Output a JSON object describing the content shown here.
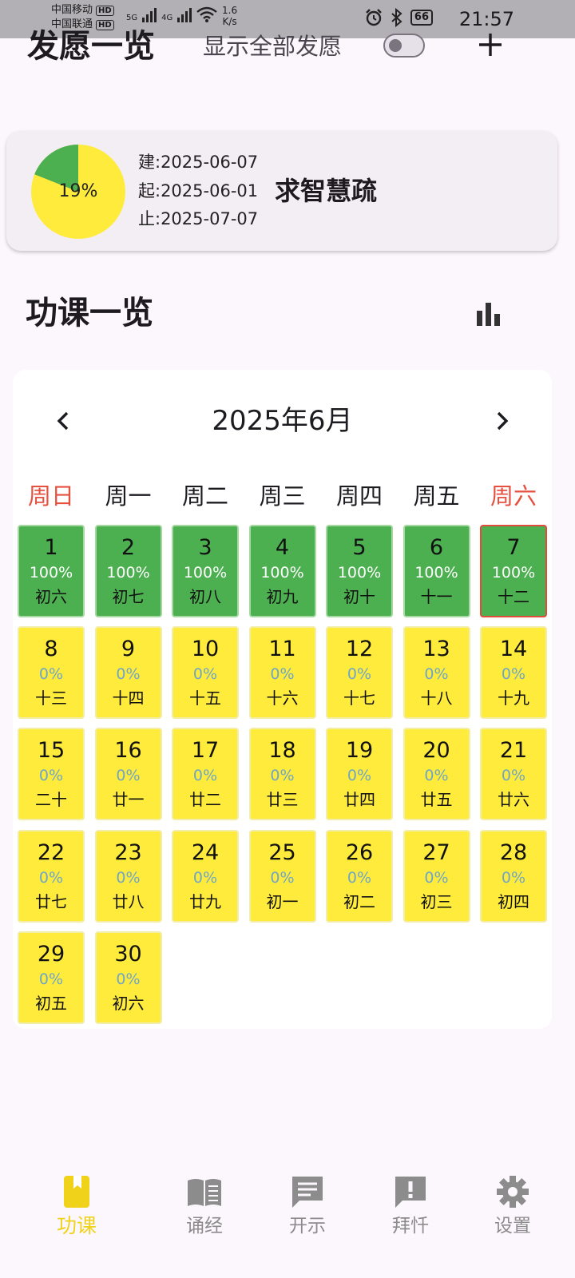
{
  "status_bar": {
    "carrier1": "中国移动",
    "carrier2": "中国联通",
    "hd": "HD",
    "net1": "5G",
    "net2": "4G",
    "speed_value": "1.6",
    "speed_unit": "K/s",
    "battery": "66",
    "time": "21:57"
  },
  "header": {
    "title": "发愿一览",
    "show_all_label": "显示全部发愿",
    "show_all_on": false
  },
  "vow": {
    "progress_percent": 19,
    "progress_label": "19%",
    "created": "建:2025-06-07",
    "start": "起:2025-06-01",
    "end": "止:2025-07-07",
    "name": "求智慧疏",
    "colors": {
      "done": "#4caf50",
      "remaining": "#ffeb3b"
    }
  },
  "section": {
    "title": "功课一览"
  },
  "calendar": {
    "month_label": "2025年6月",
    "weekdays": [
      "周日",
      "周一",
      "周二",
      "周三",
      "周四",
      "周五",
      "周六"
    ],
    "first_weekday": 0,
    "today": 7,
    "days": [
      {
        "d": "1",
        "pct": "100%",
        "lunar": "初六",
        "done": true
      },
      {
        "d": "2",
        "pct": "100%",
        "lunar": "初七",
        "done": true
      },
      {
        "d": "3",
        "pct": "100%",
        "lunar": "初八",
        "done": true
      },
      {
        "d": "4",
        "pct": "100%",
        "lunar": "初九",
        "done": true
      },
      {
        "d": "5",
        "pct": "100%",
        "lunar": "初十",
        "done": true
      },
      {
        "d": "6",
        "pct": "100%",
        "lunar": "十一",
        "done": true
      },
      {
        "d": "7",
        "pct": "100%",
        "lunar": "十二",
        "done": true
      },
      {
        "d": "8",
        "pct": "0%",
        "lunar": "十三",
        "done": false
      },
      {
        "d": "9",
        "pct": "0%",
        "lunar": "十四",
        "done": false
      },
      {
        "d": "10",
        "pct": "0%",
        "lunar": "十五",
        "done": false
      },
      {
        "d": "11",
        "pct": "0%",
        "lunar": "十六",
        "done": false
      },
      {
        "d": "12",
        "pct": "0%",
        "lunar": "十七",
        "done": false
      },
      {
        "d": "13",
        "pct": "0%",
        "lunar": "十八",
        "done": false
      },
      {
        "d": "14",
        "pct": "0%",
        "lunar": "十九",
        "done": false
      },
      {
        "d": "15",
        "pct": "0%",
        "lunar": "二十",
        "done": false
      },
      {
        "d": "16",
        "pct": "0%",
        "lunar": "廿一",
        "done": false
      },
      {
        "d": "17",
        "pct": "0%",
        "lunar": "廿二",
        "done": false
      },
      {
        "d": "18",
        "pct": "0%",
        "lunar": "廿三",
        "done": false
      },
      {
        "d": "19",
        "pct": "0%",
        "lunar": "廿四",
        "done": false
      },
      {
        "d": "20",
        "pct": "0%",
        "lunar": "廿五",
        "done": false
      },
      {
        "d": "21",
        "pct": "0%",
        "lunar": "廿六",
        "done": false
      },
      {
        "d": "22",
        "pct": "0%",
        "lunar": "廿七",
        "done": false
      },
      {
        "d": "23",
        "pct": "0%",
        "lunar": "廿八",
        "done": false
      },
      {
        "d": "24",
        "pct": "0%",
        "lunar": "廿九",
        "done": false
      },
      {
        "d": "25",
        "pct": "0%",
        "lunar": "初一",
        "done": false
      },
      {
        "d": "26",
        "pct": "0%",
        "lunar": "初二",
        "done": false
      },
      {
        "d": "27",
        "pct": "0%",
        "lunar": "初三",
        "done": false
      },
      {
        "d": "28",
        "pct": "0%",
        "lunar": "初四",
        "done": false
      },
      {
        "d": "29",
        "pct": "0%",
        "lunar": "初五",
        "done": false
      },
      {
        "d": "30",
        "pct": "0%",
        "lunar": "初六",
        "done": false
      }
    ]
  },
  "nav": {
    "items": [
      {
        "label": "功课",
        "icon": "bookmark-book-icon",
        "active": true
      },
      {
        "label": "诵经",
        "icon": "open-book-icon",
        "active": false
      },
      {
        "label": "开示",
        "icon": "message-icon",
        "active": false
      },
      {
        "label": "拜忏",
        "icon": "alert-message-icon",
        "active": false
      },
      {
        "label": "设置",
        "icon": "gear-icon",
        "active": false
      }
    ],
    "colors": {
      "active": "#f1d21a",
      "inactive": "#8c8c8c"
    }
  }
}
